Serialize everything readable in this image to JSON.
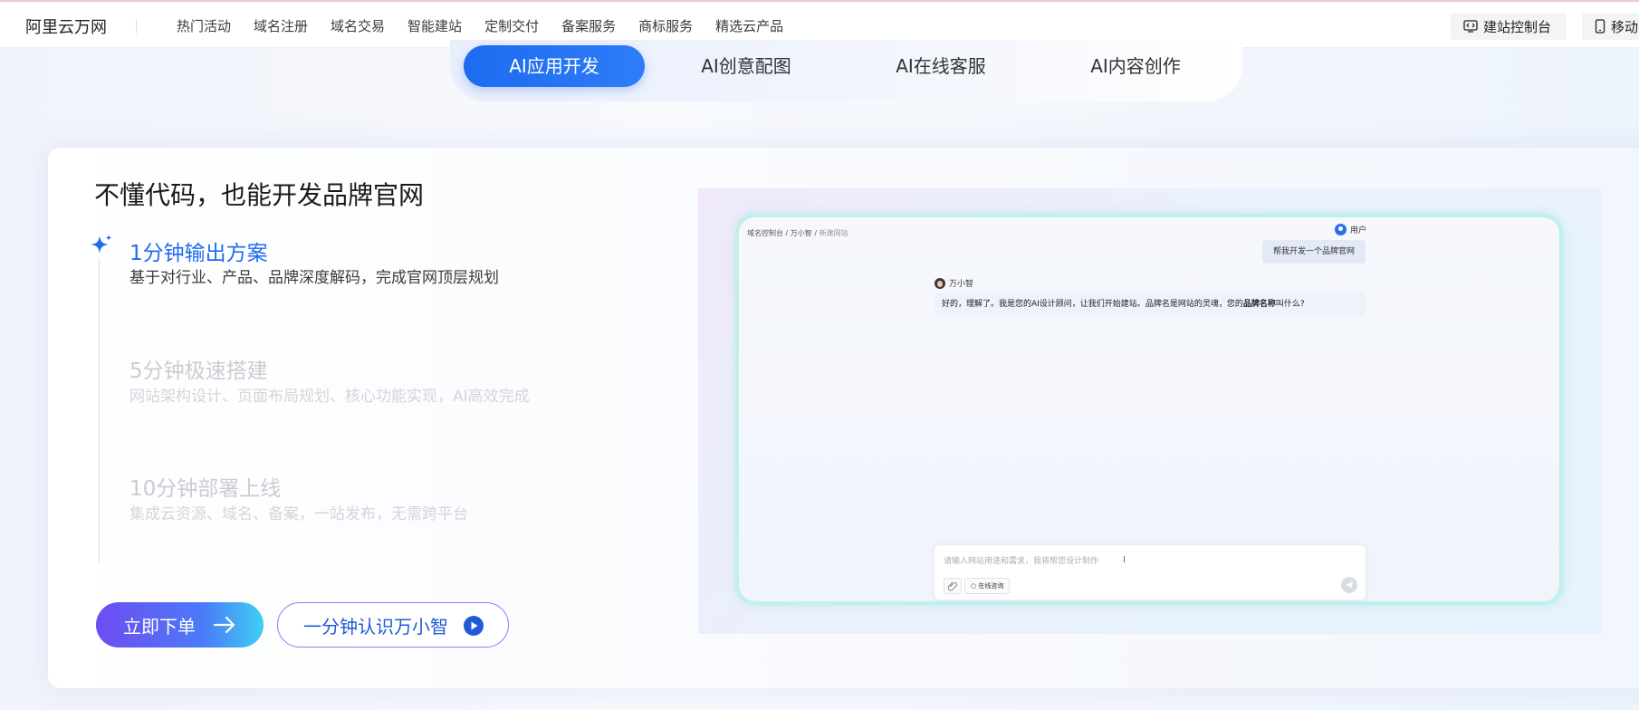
{
  "header": {
    "logo": "阿里云万网",
    "nav": [
      "热门活动",
      "域名注册",
      "域名交易",
      "智能建站",
      "定制交付",
      "备案服务",
      "商标服务",
      "精选云产品"
    ],
    "console_button": "建站控制台",
    "mobile_button": "移动"
  },
  "tabs": [
    "AI应用开发",
    "AI创意配图",
    "AI在线客服",
    "AI内容创作"
  ],
  "hero": {
    "headline": "不懂代码，也能开发品牌官网",
    "steps": [
      {
        "title": "1分钟输出方案",
        "desc": "基于对行业、产品、品牌深度解码，完成官网顶层规划"
      },
      {
        "title": "5分钟极速搭建",
        "desc": "网站架构设计、页面布局规划、核心功能实现，AI高效完成"
      },
      {
        "title": "10分钟部署上线",
        "desc": "集成云资源、域名、备案，一站发布，无需跨平台"
      }
    ],
    "order_button": "立即下单",
    "intro_button": "一分钟认识万小智"
  },
  "preview": {
    "breadcrumb": [
      "域名控制台",
      "万小智",
      "新建网站"
    ],
    "user_label": "用户",
    "user_message": "帮我开发一个品牌官网",
    "bot_label": "万小智",
    "bot_message_pre": "好的，理解了。我是您的AI设计顾问，让我们开始建站。品牌名是网站的灵魂，您的",
    "bot_message_bold": "品牌名称",
    "bot_message_post": "叫什么?",
    "input_placeholder": "请输入网站用途和需求，我将帮您设计制作",
    "consult_button": "在线咨询"
  },
  "colors": {
    "accent": "#1f6bf0",
    "active_tab": "#1d6bf0",
    "inactive_step": "#c9ccd3"
  }
}
